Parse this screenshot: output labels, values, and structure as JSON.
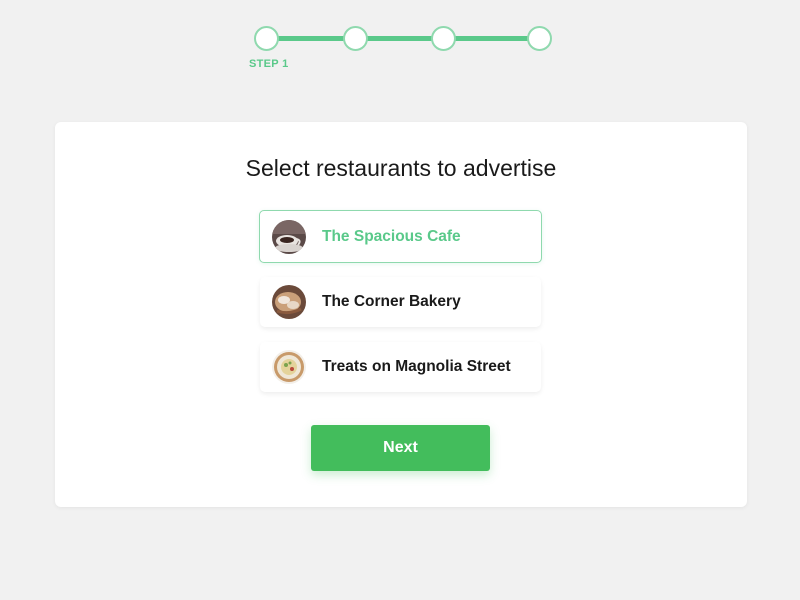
{
  "stepper": {
    "steps": [
      "step-1",
      "step-2",
      "step-3",
      "step-4"
    ],
    "current_step": 1,
    "current_label": "STEP 1",
    "accent_color": "#5ac98a"
  },
  "card": {
    "title": "Select restaurants to advertise",
    "restaurants": [
      {
        "name": "The Spacious Cafe",
        "selected": true,
        "thumbnail": "coffee-cup-photo"
      },
      {
        "name": "The Corner Bakery",
        "selected": false,
        "thumbnail": "pastry-photo"
      },
      {
        "name": "Treats on Magnolia Street",
        "selected": false,
        "thumbnail": "dish-photo"
      }
    ],
    "next_label": "Next",
    "button_color": "#43bd5c"
  }
}
